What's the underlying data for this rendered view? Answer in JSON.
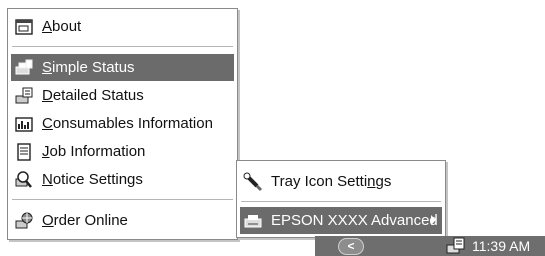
{
  "main_menu": {
    "items": [
      {
        "pre": "",
        "key": "A",
        "post": "bout",
        "icon": "about-window-icon"
      },
      {
        "pre": "",
        "key": "S",
        "post": "imple Status",
        "icon": "printer-status-icon",
        "highlighted": true
      },
      {
        "pre": "",
        "key": "D",
        "post": "etailed Status",
        "icon": "detailed-status-icon"
      },
      {
        "pre": "",
        "key": "C",
        "post": "onsumables Information",
        "icon": "ink-cartridge-icon"
      },
      {
        "pre": "",
        "key": "J",
        "post": "ob Information",
        "icon": "job-list-icon"
      },
      {
        "pre": "",
        "key": "N",
        "post": "otice Settings",
        "icon": "notice-magnifier-icon"
      },
      {
        "pre": "",
        "key": "O",
        "post": "rder Online",
        "icon": "order-online-icon"
      }
    ]
  },
  "sub_menu": {
    "items": [
      {
        "pre": "Tray Icon Setti",
        "key": "n",
        "post": "gs",
        "icon": "tray-settings-icon"
      },
      {
        "pre": "EPSON XXXX Advanced",
        "key": "",
        "post": "",
        "icon": "printer-icon",
        "highlighted": true
      }
    ]
  },
  "taskbar": {
    "chevron": "<",
    "clock": "11:39 AM"
  },
  "colors": {
    "highlight": "#6b6b6b",
    "taskbar": "#6e6e6e"
  }
}
